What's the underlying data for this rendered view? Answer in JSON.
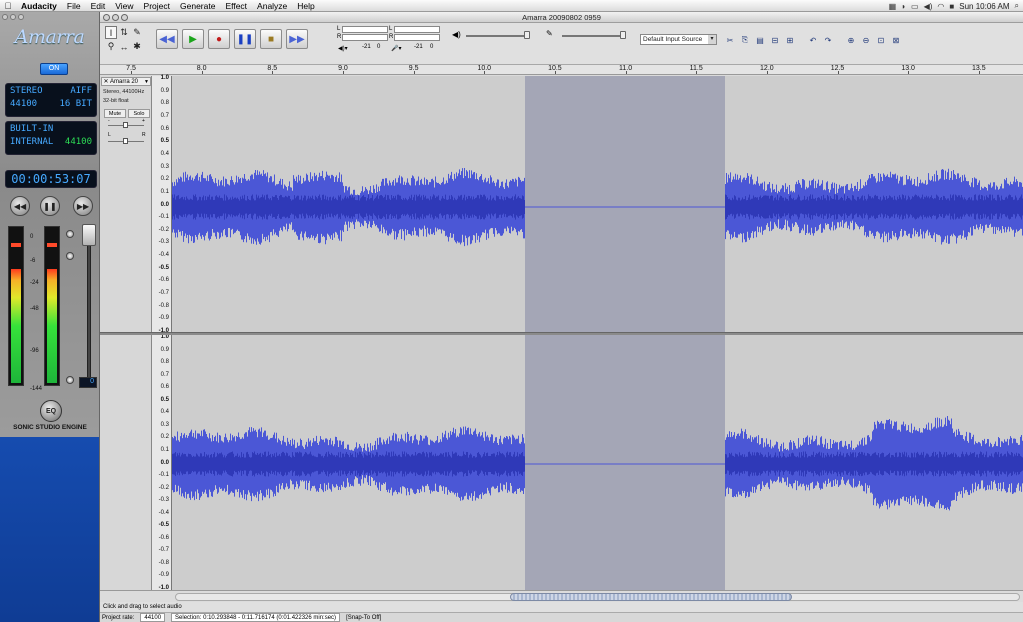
{
  "menubar": {
    "apple": "",
    "items": [
      "Audacity",
      "File",
      "Edit",
      "View",
      "Project",
      "Generate",
      "Effect",
      "Analyze",
      "Help"
    ],
    "clock": "Sun 10:06 AM"
  },
  "amarra": {
    "logo": "Amarra",
    "on_label": "ON",
    "lcd1_l1_left": "STEREO",
    "lcd1_l1_right": "AIFF",
    "lcd1_l2_left": "44100",
    "lcd1_l2_right": "16 BIT",
    "lcd2_l1": "BUILT-IN",
    "lcd2_l2_left": "INTERNAL",
    "lcd2_l2_right": "44100",
    "time": "00:00:53:07",
    "scale": [
      "0",
      "-6",
      "-24",
      "-48",
      "-96",
      "-144"
    ],
    "volume_readout": "0",
    "eq_label": "EQ",
    "engine_label": "SONIC STUDIO ENGINE"
  },
  "window": {
    "title": "Amarra 20090802 0959"
  },
  "meters": {
    "L": "L",
    "R": "R",
    "play_scale_a": "-21",
    "play_scale_b": "0",
    "rec_scale_a": "-21",
    "rec_scale_b": "0"
  },
  "input_source": "Default Input Source",
  "ruler": {
    "labels": [
      "7.5",
      "8.0",
      "8.5",
      "9.0",
      "9.5",
      "10.0",
      "10.5",
      "11.0",
      "11.5",
      "12.0",
      "12.5",
      "13.0",
      "13.5"
    ]
  },
  "track": {
    "name": "Amarra 20",
    "info1": "Stereo, 44100Hz",
    "info2": "32-bit float",
    "mute": "Mute",
    "solo": "Solo",
    "minus": "-",
    "plus": "+",
    "L": "L",
    "R": "R",
    "vlabels": [
      "1.0",
      "0.9",
      "0.8",
      "0.7",
      "0.6",
      "0.5",
      "0.4",
      "0.3",
      "0.2",
      "0.1",
      "0.0",
      "-0.1",
      "-0.2",
      "-0.3",
      "-0.4",
      "-0.5",
      "-0.6",
      "-0.7",
      "-0.8",
      "-0.9",
      "-1.0"
    ]
  },
  "status": {
    "hint": "Click and drag to select audio",
    "project_rate_label": "Project rate:",
    "project_rate": "44100",
    "selection": "Selection: 0:10.293848 - 0:11.716174 (0:01.422326 min:sec)",
    "snap": "[Snap-To Off]"
  },
  "colors": {
    "waveform": "#4b57d6",
    "selection": "#a4a6b6"
  }
}
